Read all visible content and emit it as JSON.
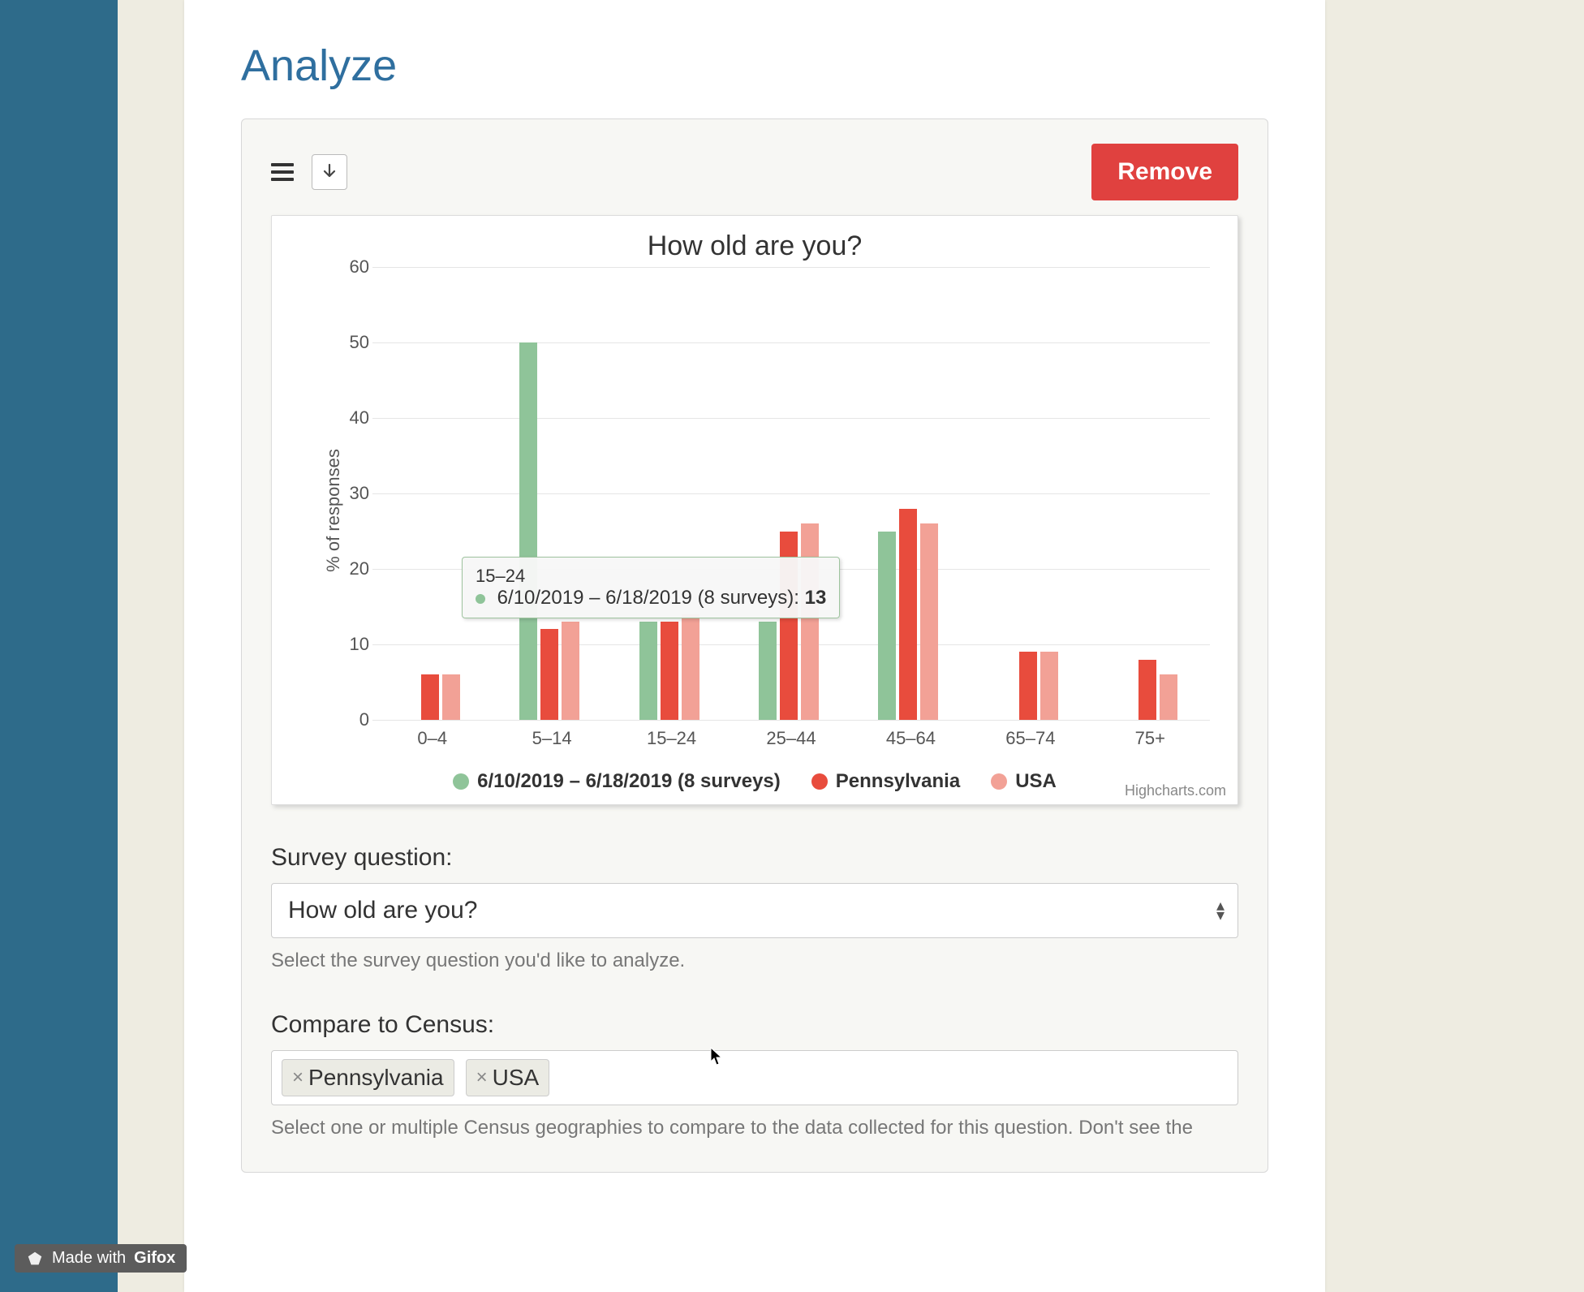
{
  "page": {
    "title": "Analyze"
  },
  "toolbar": {
    "remove_label": "Remove"
  },
  "chart_data": {
    "type": "bar",
    "title": "How old are you?",
    "ylabel": "% of responses",
    "ylim": [
      0,
      60
    ],
    "yticks": [
      0,
      10,
      20,
      30,
      40,
      50,
      60
    ],
    "categories": [
      "0–4",
      "5–14",
      "15–24",
      "25–44",
      "45–64",
      "65–74",
      "75+"
    ],
    "series": [
      {
        "name": "6/10/2019 – 6/18/2019 (8 surveys)",
        "color": "#8fc499",
        "values": [
          0,
          50,
          13,
          13,
          25,
          0,
          0
        ]
      },
      {
        "name": "Pennsylvania",
        "color": "#e84c3d",
        "values": [
          6,
          12,
          13,
          25,
          28,
          9,
          8
        ]
      },
      {
        "name": "USA",
        "color": "#f2a196",
        "values": [
          6,
          13,
          14,
          26,
          26,
          9,
          6
        ]
      }
    ],
    "credits": "Highcharts.com",
    "tooltip": {
      "category": "15–24",
      "series_label": "6/10/2019 – 6/18/2019 (8 surveys):",
      "value": "13",
      "dot_color": "#8fc499"
    }
  },
  "form": {
    "question_label": "Survey question:",
    "question_value": "How old are you?",
    "question_helper": "Select the survey question you'd like to analyze.",
    "compare_label": "Compare to Census:",
    "compare_tags": [
      "Pennsylvania",
      "USA"
    ],
    "compare_helper": "Select one or multiple Census geographies to compare to the data collected for this question. Don't see the"
  },
  "gifox": {
    "prefix": "Made with",
    "brand": "Gifox"
  }
}
